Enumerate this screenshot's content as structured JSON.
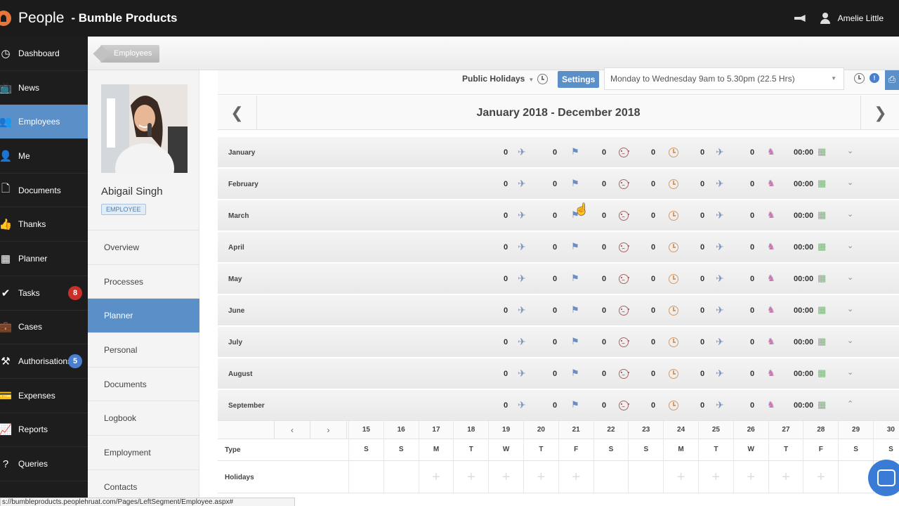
{
  "app": {
    "name": "People",
    "company": "- Bumble Products",
    "user": "Amelie Little"
  },
  "colors": {
    "accent": "#5b8fc7",
    "badge_red": "#c9302c",
    "badge_blue": "#4a7fcf"
  },
  "sidebar": {
    "items": [
      {
        "label": "Dashboard",
        "icon": "dashboard-icon",
        "glyph": "◷"
      },
      {
        "label": "News",
        "icon": "tv-icon",
        "glyph": "📺"
      },
      {
        "label": "Employees",
        "icon": "users-icon",
        "glyph": "👥"
      },
      {
        "label": "Me",
        "icon": "user-icon",
        "glyph": "👤"
      },
      {
        "label": "Documents",
        "icon": "document-icon",
        "glyph": "🗋"
      },
      {
        "label": "Thanks",
        "icon": "thumbs-up-icon",
        "glyph": "👍"
      },
      {
        "label": "Planner",
        "icon": "planner-icon",
        "glyph": "▦"
      },
      {
        "label": "Tasks",
        "icon": "check-icon",
        "glyph": "✔",
        "badge": "8"
      },
      {
        "label": "Cases",
        "icon": "briefcase-icon",
        "glyph": "💼"
      },
      {
        "label": "Authorisations",
        "icon": "gavel-icon",
        "glyph": "⚒",
        "badge": "5"
      },
      {
        "label": "Expenses",
        "icon": "wallet-icon",
        "glyph": "💳"
      },
      {
        "label": "Reports",
        "icon": "chart-icon",
        "glyph": "📈"
      },
      {
        "label": "Queries",
        "icon": "query-icon",
        "glyph": "?"
      }
    ]
  },
  "breadcrumb": {
    "label": "Employees"
  },
  "profile": {
    "name": "Abigail Singh",
    "badge": "EMPLOYEE",
    "menu": [
      "Overview",
      "Processes",
      "Planner",
      "Personal",
      "Documents",
      "Logbook",
      "Employment",
      "Contacts"
    ]
  },
  "toolbar": {
    "filter_label": "Public Holidays",
    "settings_label": "Settings",
    "schedule_value": "Monday to Wednesday 9am to 5.30pm (22.5 Hrs)"
  },
  "planner": {
    "year_title": "January 2018 - December 2018",
    "months": [
      "January",
      "February",
      "March",
      "April",
      "May",
      "June",
      "July",
      "August",
      "September"
    ],
    "counts": [
      "0",
      "0",
      "0",
      "0",
      "0",
      "0"
    ],
    "time": "00:00",
    "days": [
      "15",
      "16",
      "17",
      "18",
      "19",
      "20",
      "21",
      "22",
      "23",
      "24",
      "25",
      "26",
      "27",
      "28",
      "29",
      "30"
    ],
    "weekdays": [
      "S",
      "S",
      "M",
      "T",
      "W",
      "T",
      "F",
      "S",
      "S",
      "M",
      "T",
      "W",
      "T",
      "F",
      "S",
      "S"
    ],
    "type_label": "Type",
    "holidays_label": "Holidays"
  },
  "status_url": "s://bumbleproducts.peoplehruat.com/Pages/LeftSegment/Employee.aspx#"
}
